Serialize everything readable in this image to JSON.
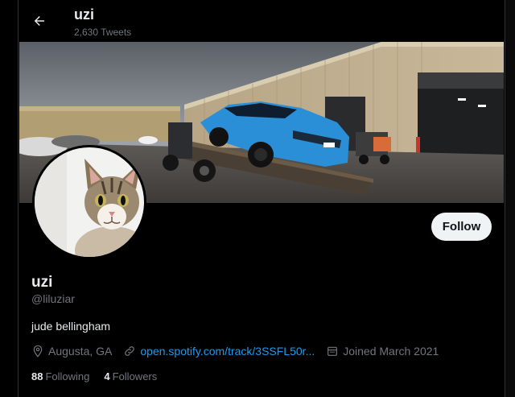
{
  "header": {
    "name": "uzi",
    "tweet_count": "2,630 Tweets"
  },
  "profile": {
    "display_name": "uzi",
    "handle": "@liluziar",
    "bio": "jude bellingham",
    "location": "Augusta, GA",
    "link": "open.spotify.com/track/3SSFL50r...",
    "joined": "Joined March 2021"
  },
  "actions": {
    "follow_label": "Follow"
  },
  "stats": {
    "following_count": "88",
    "following_label": "Following",
    "followers_count": "4",
    "followers_label": "Followers"
  },
  "colors": {
    "background": "#000000",
    "primary_text": "#e7e9ea",
    "secondary_text": "#71767b",
    "link": "#1d9bf0",
    "follow_button_bg": "#eff3f4",
    "car": "#2a8fd6"
  },
  "icons": {
    "back": "arrow-left-icon",
    "location": "location-pin-icon",
    "link": "link-icon",
    "calendar": "calendar-icon"
  }
}
